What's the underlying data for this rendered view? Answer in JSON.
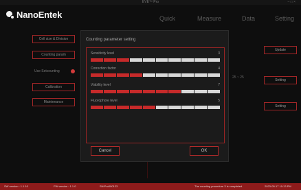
{
  "window": {
    "title": "EVE™ Pro",
    "controls": "–  □  ×"
  },
  "brand": "NanoEntek",
  "nav": [
    "Quick",
    "Measure",
    "Data",
    "Setting"
  ],
  "left_buttons": [
    "Cell size & Division",
    "Counting param",
    "Use Setcounting",
    "Calibration",
    "Maintenance"
  ],
  "right_buttons": [
    "Update",
    "Setting",
    "Setting"
  ],
  "right_text": "25 ~ 25",
  "modal": {
    "title": "Counting parameter setting",
    "params": [
      {
        "label": "Sensitivity level",
        "value": "3",
        "filled": 3,
        "segments": 10
      },
      {
        "label": "Correction factor",
        "value": "4",
        "filled": 4,
        "segments": 10
      },
      {
        "label": "Viability level",
        "value": "7",
        "filled": 7,
        "segments": 10
      },
      {
        "label": "Fluorophore level",
        "value": "5",
        "filled": 5,
        "segments": 10
      }
    ],
    "cancel": "Cancel",
    "ok": "OK"
  },
  "status": {
    "sw_version": "SW version : 1.1.10",
    "fw_version": "FW version : 1.1.0",
    "serial": "SN:Pro000123",
    "message": "The counting procedure 3 is completed.",
    "datetime": "2023-05-17 10:13 PM"
  },
  "colors": {
    "accent": "#c62a2a",
    "status_bar": "#8e1b1b",
    "background": "#0e0e0e"
  }
}
